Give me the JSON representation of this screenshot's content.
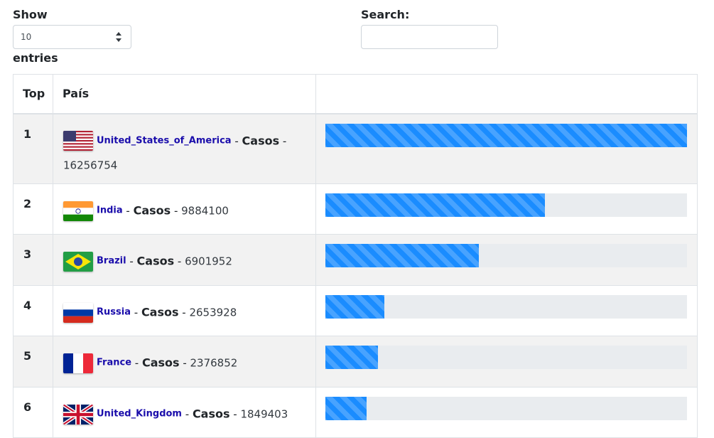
{
  "length_control": {
    "show_label": "Show",
    "selected": "10",
    "entries_label": "entries"
  },
  "search": {
    "label": "Search:",
    "value": ""
  },
  "table": {
    "headers": {
      "rank": "Top",
      "country": "País",
      "bar": ""
    },
    "casos_label": "Casos",
    "rows": [
      {
        "rank": "1",
        "country": "United_States_of_America",
        "flag": "usa-flag-icon",
        "cases": "16256754",
        "fraction": 1.0
      },
      {
        "rank": "2",
        "country": "India",
        "flag": "india-flag-icon",
        "cases": "9884100",
        "fraction": 0.608
      },
      {
        "rank": "3",
        "country": "Brazil",
        "flag": "brazil-flag-icon",
        "cases": "6901952",
        "fraction": 0.4246
      },
      {
        "rank": "4",
        "country": "Russia",
        "flag": "russia-flag-icon",
        "cases": "2653928",
        "fraction": 0.1633
      },
      {
        "rank": "5",
        "country": "France",
        "flag": "france-flag-icon",
        "cases": "2376852",
        "fraction": 0.1462
      },
      {
        "rank": "6",
        "country": "United_Kingdom",
        "flag": "uk-flag-icon",
        "cases": "1849403",
        "fraction": 0.1138
      }
    ]
  },
  "colors": {
    "bar_fill": "#1a8cff",
    "bar_track": "#e9ecef",
    "link": "#1a0dab"
  }
}
